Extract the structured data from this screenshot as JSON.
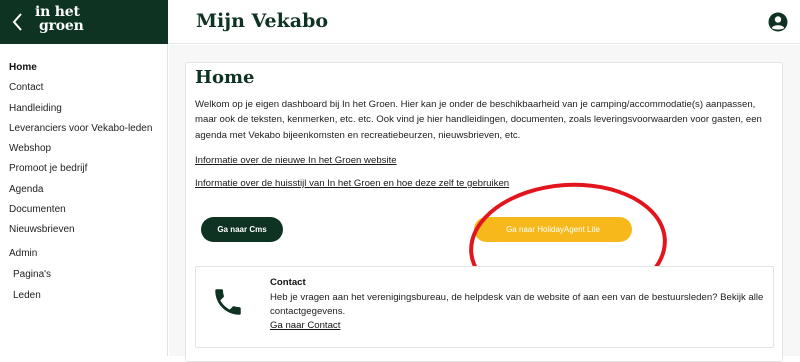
{
  "brand": {
    "logo_line1": "in het",
    "logo_line2": "groen",
    "back_icon": "chevron-left-icon"
  },
  "header": {
    "title": "Mijn Vekabo",
    "user_icon": "user-circle-icon"
  },
  "sidebar": {
    "items": [
      {
        "label": "Home",
        "active": true
      },
      {
        "label": "Contact"
      },
      {
        "label": "Handleiding"
      },
      {
        "label": "Leveranciers voor Vekabo-leden"
      },
      {
        "label": "Webshop"
      },
      {
        "label": "Promoot je bedrijf"
      },
      {
        "label": "Agenda"
      },
      {
        "label": "Documenten"
      },
      {
        "label": "Nieuwsbrieven"
      },
      {
        "label": "Admin"
      },
      {
        "label": "Pagina's"
      },
      {
        "label": "Leden"
      }
    ]
  },
  "main": {
    "heading": "Home",
    "intro": "Welkom op je eigen dashboard bij In het Groen. Hier kan je onder de beschikbaarheid van je camping/accommodatie(s) aanpassen, maar ook de teksten, kenmerken, etc. etc. Ook vind je hier handleidingen, documenten, zoals leveringsvoorwaarden voor gasten, een agenda met Vekabo bijeenkomsten en recreatiebeurzen, nieuwsbrieven, etc.",
    "link1": "Informatie over de nieuwe In het Groen website",
    "link2": "Informatie over de huisstijl van In het Groen en hoe deze zelf te gebruiken",
    "button_cms": "Ga naar Cms",
    "button_holidayagent": "Ga naar HolidayAgent Lite"
  },
  "contact": {
    "icon": "phone-icon",
    "title": "Contact",
    "text": "Heb je vragen aan het verenigingsbureau, de helpdesk van de website of aan een van de bestuursleden? Bekijk alle contactgegevens.",
    "link": "Ga naar Contact"
  },
  "colors": {
    "brand_green": "#0e3323",
    "accent_yellow": "#f7b81c",
    "highlight_red": "#e3151c"
  }
}
